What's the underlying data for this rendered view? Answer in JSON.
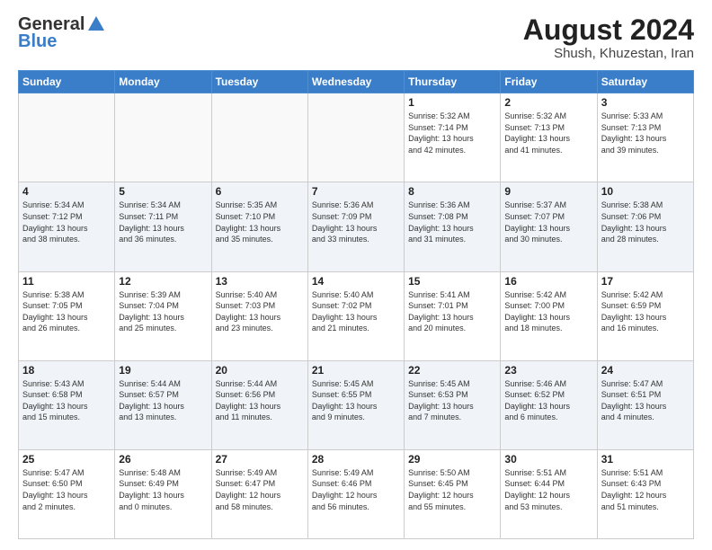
{
  "header": {
    "logo_general": "General",
    "logo_blue": "Blue",
    "month_year": "August 2024",
    "location": "Shush, Khuzestan, Iran"
  },
  "weekdays": [
    "Sunday",
    "Monday",
    "Tuesday",
    "Wednesday",
    "Thursday",
    "Friday",
    "Saturday"
  ],
  "weeks": [
    [
      {
        "day": "",
        "info": ""
      },
      {
        "day": "",
        "info": ""
      },
      {
        "day": "",
        "info": ""
      },
      {
        "day": "",
        "info": ""
      },
      {
        "day": "1",
        "info": "Sunrise: 5:32 AM\nSunset: 7:14 PM\nDaylight: 13 hours\nand 42 minutes."
      },
      {
        "day": "2",
        "info": "Sunrise: 5:32 AM\nSunset: 7:13 PM\nDaylight: 13 hours\nand 41 minutes."
      },
      {
        "day": "3",
        "info": "Sunrise: 5:33 AM\nSunset: 7:13 PM\nDaylight: 13 hours\nand 39 minutes."
      }
    ],
    [
      {
        "day": "4",
        "info": "Sunrise: 5:34 AM\nSunset: 7:12 PM\nDaylight: 13 hours\nand 38 minutes."
      },
      {
        "day": "5",
        "info": "Sunrise: 5:34 AM\nSunset: 7:11 PM\nDaylight: 13 hours\nand 36 minutes."
      },
      {
        "day": "6",
        "info": "Sunrise: 5:35 AM\nSunset: 7:10 PM\nDaylight: 13 hours\nand 35 minutes."
      },
      {
        "day": "7",
        "info": "Sunrise: 5:36 AM\nSunset: 7:09 PM\nDaylight: 13 hours\nand 33 minutes."
      },
      {
        "day": "8",
        "info": "Sunrise: 5:36 AM\nSunset: 7:08 PM\nDaylight: 13 hours\nand 31 minutes."
      },
      {
        "day": "9",
        "info": "Sunrise: 5:37 AM\nSunset: 7:07 PM\nDaylight: 13 hours\nand 30 minutes."
      },
      {
        "day": "10",
        "info": "Sunrise: 5:38 AM\nSunset: 7:06 PM\nDaylight: 13 hours\nand 28 minutes."
      }
    ],
    [
      {
        "day": "11",
        "info": "Sunrise: 5:38 AM\nSunset: 7:05 PM\nDaylight: 13 hours\nand 26 minutes."
      },
      {
        "day": "12",
        "info": "Sunrise: 5:39 AM\nSunset: 7:04 PM\nDaylight: 13 hours\nand 25 minutes."
      },
      {
        "day": "13",
        "info": "Sunrise: 5:40 AM\nSunset: 7:03 PM\nDaylight: 13 hours\nand 23 minutes."
      },
      {
        "day": "14",
        "info": "Sunrise: 5:40 AM\nSunset: 7:02 PM\nDaylight: 13 hours\nand 21 minutes."
      },
      {
        "day": "15",
        "info": "Sunrise: 5:41 AM\nSunset: 7:01 PM\nDaylight: 13 hours\nand 20 minutes."
      },
      {
        "day": "16",
        "info": "Sunrise: 5:42 AM\nSunset: 7:00 PM\nDaylight: 13 hours\nand 18 minutes."
      },
      {
        "day": "17",
        "info": "Sunrise: 5:42 AM\nSunset: 6:59 PM\nDaylight: 13 hours\nand 16 minutes."
      }
    ],
    [
      {
        "day": "18",
        "info": "Sunrise: 5:43 AM\nSunset: 6:58 PM\nDaylight: 13 hours\nand 15 minutes."
      },
      {
        "day": "19",
        "info": "Sunrise: 5:44 AM\nSunset: 6:57 PM\nDaylight: 13 hours\nand 13 minutes."
      },
      {
        "day": "20",
        "info": "Sunrise: 5:44 AM\nSunset: 6:56 PM\nDaylight: 13 hours\nand 11 minutes."
      },
      {
        "day": "21",
        "info": "Sunrise: 5:45 AM\nSunset: 6:55 PM\nDaylight: 13 hours\nand 9 minutes."
      },
      {
        "day": "22",
        "info": "Sunrise: 5:45 AM\nSunset: 6:53 PM\nDaylight: 13 hours\nand 7 minutes."
      },
      {
        "day": "23",
        "info": "Sunrise: 5:46 AM\nSunset: 6:52 PM\nDaylight: 13 hours\nand 6 minutes."
      },
      {
        "day": "24",
        "info": "Sunrise: 5:47 AM\nSunset: 6:51 PM\nDaylight: 13 hours\nand 4 minutes."
      }
    ],
    [
      {
        "day": "25",
        "info": "Sunrise: 5:47 AM\nSunset: 6:50 PM\nDaylight: 13 hours\nand 2 minutes."
      },
      {
        "day": "26",
        "info": "Sunrise: 5:48 AM\nSunset: 6:49 PM\nDaylight: 13 hours\nand 0 minutes."
      },
      {
        "day": "27",
        "info": "Sunrise: 5:49 AM\nSunset: 6:47 PM\nDaylight: 12 hours\nand 58 minutes."
      },
      {
        "day": "28",
        "info": "Sunrise: 5:49 AM\nSunset: 6:46 PM\nDaylight: 12 hours\nand 56 minutes."
      },
      {
        "day": "29",
        "info": "Sunrise: 5:50 AM\nSunset: 6:45 PM\nDaylight: 12 hours\nand 55 minutes."
      },
      {
        "day": "30",
        "info": "Sunrise: 5:51 AM\nSunset: 6:44 PM\nDaylight: 12 hours\nand 53 minutes."
      },
      {
        "day": "31",
        "info": "Sunrise: 5:51 AM\nSunset: 6:43 PM\nDaylight: 12 hours\nand 51 minutes."
      }
    ]
  ]
}
